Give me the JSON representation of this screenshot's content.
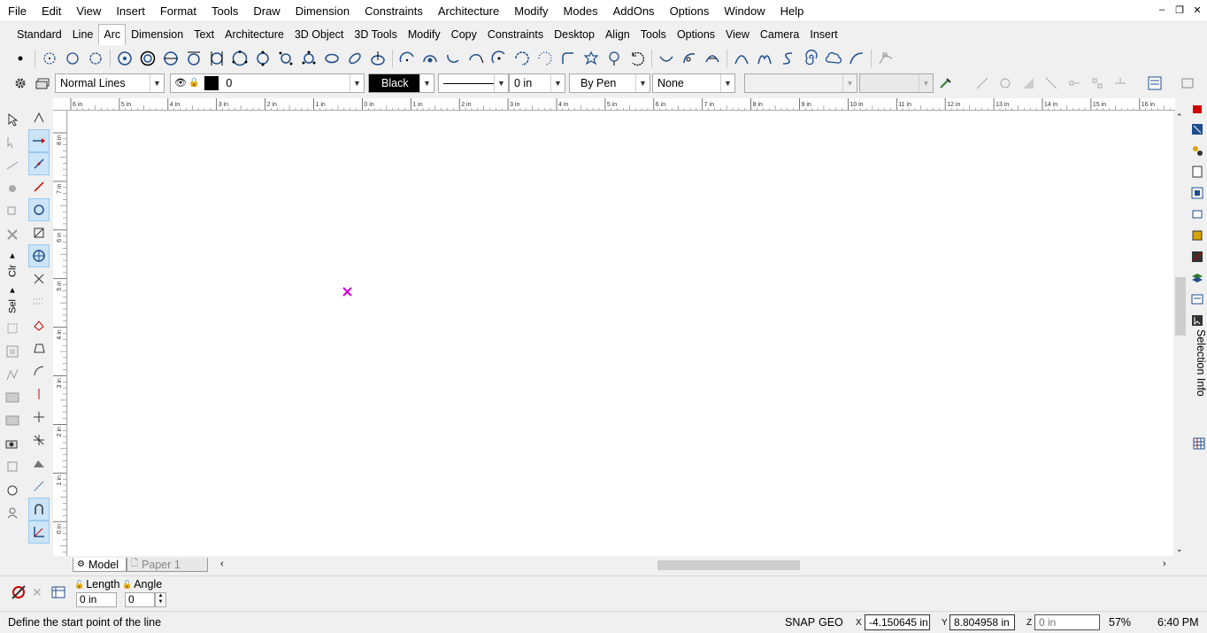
{
  "menu": [
    "File",
    "Edit",
    "View",
    "Insert",
    "Format",
    "Tools",
    "Draw",
    "Dimension",
    "Constraints",
    "Architecture",
    "Modify",
    "Modes",
    "AddOns",
    "Options",
    "Window",
    "Help"
  ],
  "window_controls": {
    "minimize": "–",
    "restore": "❐",
    "close": "✕"
  },
  "tabs": [
    {
      "label": "Standard",
      "active": false
    },
    {
      "label": "Line",
      "active": false
    },
    {
      "label": "Arc",
      "active": true
    },
    {
      "label": "Dimension",
      "active": false
    },
    {
      "label": "Text",
      "active": false
    },
    {
      "label": "Architecture",
      "active": false
    },
    {
      "label": "3D Object",
      "active": false
    },
    {
      "label": "3D Tools",
      "active": false
    },
    {
      "label": "Modify",
      "active": false
    },
    {
      "label": "Copy",
      "active": false
    },
    {
      "label": "Constraints",
      "active": false
    },
    {
      "label": "Desktop",
      "active": false
    },
    {
      "label": "Align",
      "active": false
    },
    {
      "label": "Tools",
      "active": false
    },
    {
      "label": "Options",
      "active": false
    },
    {
      "label": "View",
      "active": false
    },
    {
      "label": "Camera",
      "active": false
    },
    {
      "label": "Insert",
      "active": false
    }
  ],
  "properties": {
    "layer_style": "Normal Lines",
    "layer_value": "0",
    "color_name": "Black",
    "line_width": "0 in",
    "pen_mode": "By Pen",
    "fill": "None"
  },
  "colors": {
    "accent_selected": "#cce4f7",
    "marker": "#d400d4",
    "swatch": "#000000"
  },
  "ruler": {
    "h_labels": [
      "6 in",
      "5 in",
      "4 in",
      "3 in",
      "2 in",
      "1 in",
      "0 in",
      "1 in",
      "2 in",
      "3 in",
      "4 in",
      "5 in",
      "6 in",
      "7 in",
      "8 in",
      "9 in",
      "10 in",
      "11 in",
      "12 in",
      "13 in",
      "14 in",
      "15 in",
      "16 in",
      "17 in"
    ],
    "v_labels": [
      "8 in",
      "7 in",
      "6 in",
      "5 in",
      "4 in",
      "3 in",
      "2 in",
      "1 in",
      "0 in"
    ]
  },
  "sheets": [
    {
      "label": "Model",
      "active": true
    },
    {
      "label": "Paper 1",
      "active": false
    }
  ],
  "side_panel_label": "Selection Info",
  "input_fields": {
    "length_label": "Length",
    "length_value": "0 in",
    "angle_label": "Angle",
    "angle_value": "0"
  },
  "status": {
    "prompt": "Define the start point of the line",
    "snap": "SNAP",
    "geo": "GEO",
    "x_label": "X",
    "x_value": "-4.150645 in",
    "y_label": "Y",
    "y_value": "8.804958 in",
    "z_label": "Z",
    "z_placeholder": "0 in",
    "zoom": "57%",
    "time": "6:40 PM"
  }
}
